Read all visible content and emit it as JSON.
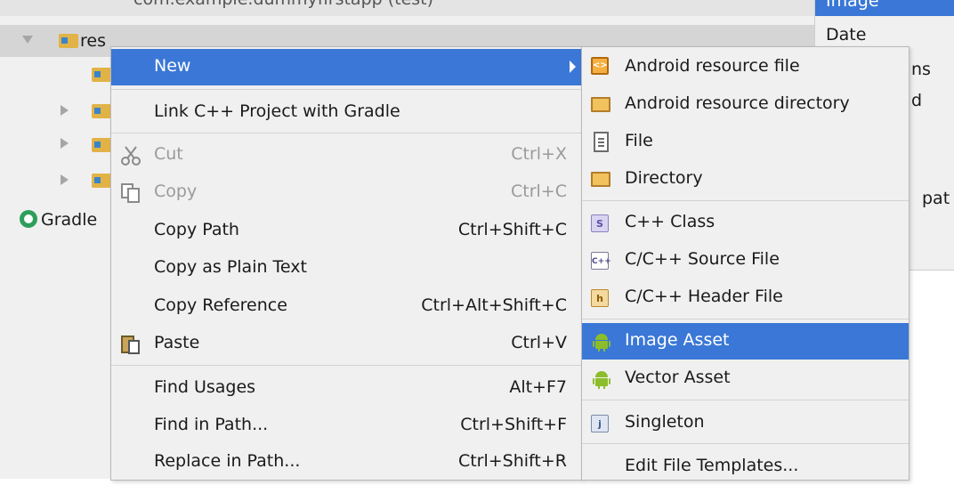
{
  "tree": {
    "top_item": "com.example.dummyfirstapp (test)",
    "res_label": "res",
    "gradle_label": "Gradle"
  },
  "side_panel": {
    "items": [
      "Image",
      "Date",
      "ns",
      "d",
      "pat"
    ]
  },
  "context_menu": {
    "items": [
      {
        "label": "New",
        "shortcut": "",
        "has_submenu": true,
        "selected": true
      },
      {
        "label": "Link C++ Project with Gradle",
        "shortcut": ""
      },
      {
        "label": "Cut",
        "shortcut": "Ctrl+X",
        "disabled": true,
        "icon": "scissors-icon"
      },
      {
        "label": "Copy",
        "shortcut": "Ctrl+C",
        "disabled": true,
        "icon": "copy-icon"
      },
      {
        "label": "Copy Path",
        "shortcut": "Ctrl+Shift+C"
      },
      {
        "label": "Copy as Plain Text",
        "shortcut": ""
      },
      {
        "label": "Copy Reference",
        "shortcut": "Ctrl+Alt+Shift+C"
      },
      {
        "label": "Paste",
        "shortcut": "Ctrl+V",
        "icon": "paste-icon"
      },
      {
        "label": "Find Usages",
        "shortcut": "Alt+F7"
      },
      {
        "label": "Find in Path...",
        "shortcut": "Ctrl+Shift+F"
      },
      {
        "label": "Replace in Path...",
        "shortcut": "Ctrl+Shift+R"
      }
    ]
  },
  "submenu": {
    "items": [
      {
        "label": "Android resource file",
        "icon": "android-resource-file-icon"
      },
      {
        "label": "Android resource directory",
        "icon": "folder-icon"
      },
      {
        "label": "File",
        "icon": "file-icon"
      },
      {
        "label": "Directory",
        "icon": "folder-icon"
      },
      {
        "label": "C++ Class",
        "icon": "cpp-class-icon"
      },
      {
        "label": "C/C++ Source File",
        "icon": "cpp-source-icon"
      },
      {
        "label": "C/C++ Header File",
        "icon": "header-file-icon"
      },
      {
        "label": "Image Asset",
        "icon": "android-icon",
        "selected": true
      },
      {
        "label": "Vector Asset",
        "icon": "android-icon"
      },
      {
        "label": "Singleton",
        "icon": "singleton-icon"
      },
      {
        "label": "Edit File Templates...",
        "icon": ""
      }
    ]
  },
  "colors": {
    "selection": "#3a77d6",
    "menu_bg": "#f0f0f0",
    "android_green": "#8cbd2b",
    "folder": "#e1b347"
  }
}
